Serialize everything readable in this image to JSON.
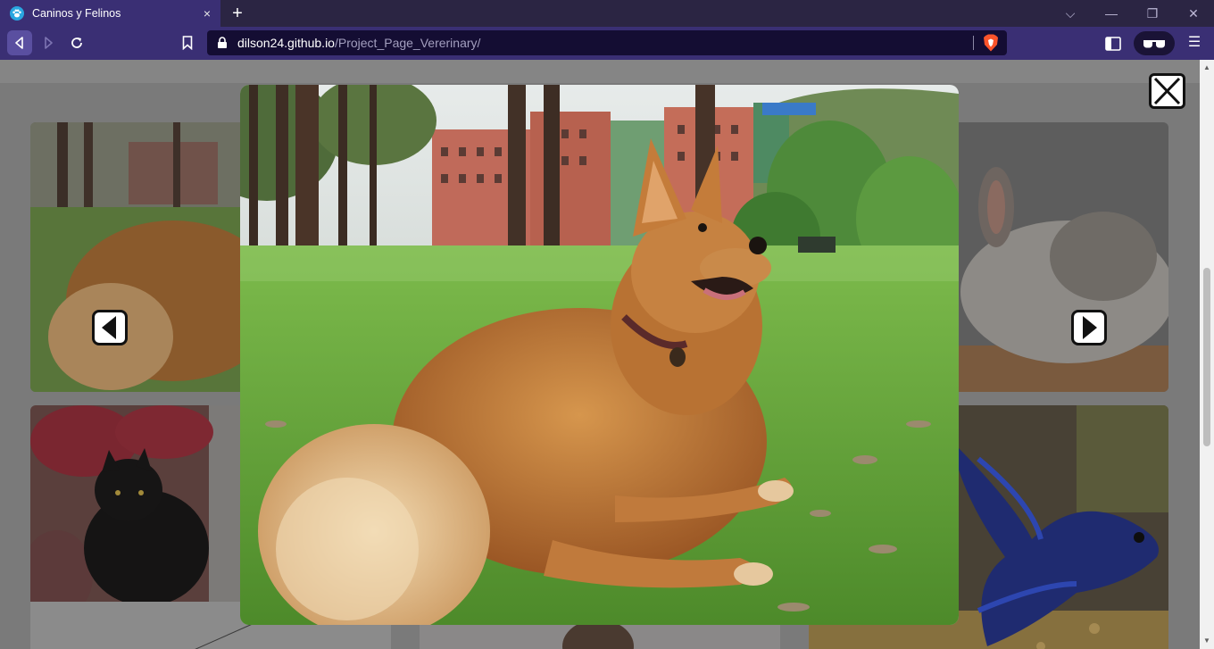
{
  "browser": {
    "tab_title": "Caninos y Felinos",
    "tab_close": "×",
    "new_tab": "+",
    "url_host": "dilson24.github.io",
    "url_path": "/Project_Page_Vererinary/",
    "window_controls": {
      "dropdown": "⌵",
      "minimize": "—",
      "restore": "❐",
      "close": "✕"
    },
    "menu": "☰"
  },
  "gallery": {
    "cards": [
      {
        "id": "dog-card",
        "subject": "dog-lying-on-grass"
      },
      {
        "id": "rabbit-card",
        "subject": "grey-rabbit"
      },
      {
        "id": "cat-card",
        "subject": "black-cat-with-poinsettia"
      },
      {
        "id": "fish-card",
        "subject": "blue-betta-fish"
      }
    ]
  },
  "lightbox": {
    "image_subject": "fluffy-orange-dog-lying-on-grass-in-park",
    "close_icon": "close-x-icon",
    "prev_icon": "arrow-left-icon",
    "next_icon": "arrow-right-icon"
  },
  "colors": {
    "chrome_dark": "#2b2543",
    "chrome_accent": "#3a2f74",
    "urlbar_bg": "#140d33",
    "overlay": "#7a7a7a",
    "brave_orange": "#fb542b"
  }
}
